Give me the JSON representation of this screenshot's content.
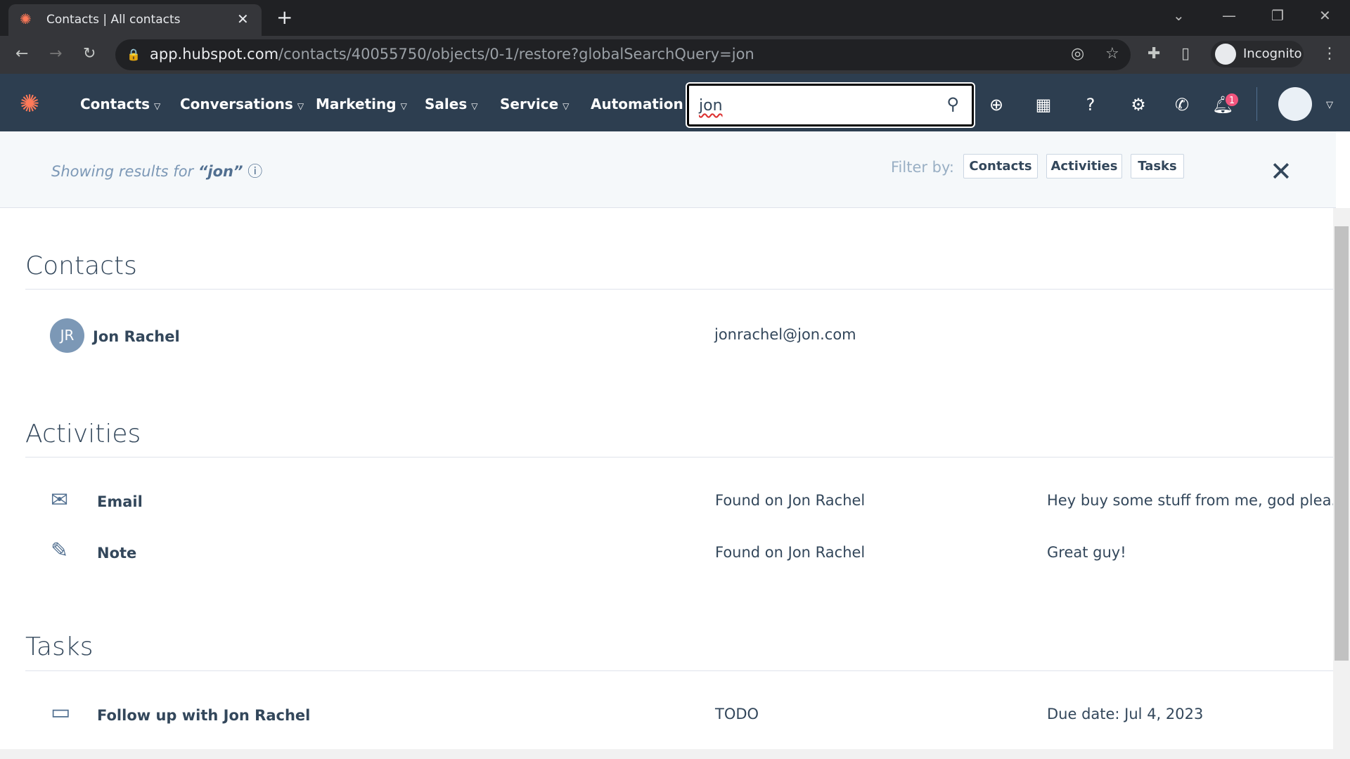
{
  "browser": {
    "tab_title": "Contacts | All contacts",
    "url_host": "app.hubspot.com",
    "url_path": "/contacts/40055750/objects/0-1/restore?globalSearchQuery=jon",
    "profile": "Incognito"
  },
  "nav": {
    "items": [
      "Contacts",
      "Conversations",
      "Marketing",
      "Sales",
      "Service",
      "Automation"
    ],
    "search_value": "jon",
    "notification_count": "1"
  },
  "filterbar": {
    "showing_prefix": "Showing results for ",
    "query": "“jon”",
    "filter_label": "Filter by:",
    "filters": [
      "Contacts",
      "Activities",
      "Tasks"
    ]
  },
  "contacts": {
    "heading": "Contacts",
    "rows": [
      {
        "initials": "JR",
        "name": "Jon Rachel",
        "email": "jonrachel@jon.com"
      }
    ]
  },
  "activities": {
    "heading": "Activities",
    "rows": [
      {
        "icon": "envelope-icon",
        "type": "Email",
        "found": "Found on Jon Rachel",
        "preview": "Hey buy some stuff from me, god plea..."
      },
      {
        "icon": "pencil-square-icon",
        "type": "Note",
        "found": "Found on Jon Rachel",
        "preview": "Great guy!"
      }
    ]
  },
  "tasks": {
    "heading": "Tasks",
    "rows": [
      {
        "icon": "task-icon",
        "title": "Follow up with Jon Rachel",
        "status": "TODO",
        "due": "Due date: Jul 4, 2023"
      }
    ]
  },
  "colors": {
    "nav_bg": "#2d3e50",
    "accent": "#ff7a59",
    "badge": "#f2547d"
  }
}
